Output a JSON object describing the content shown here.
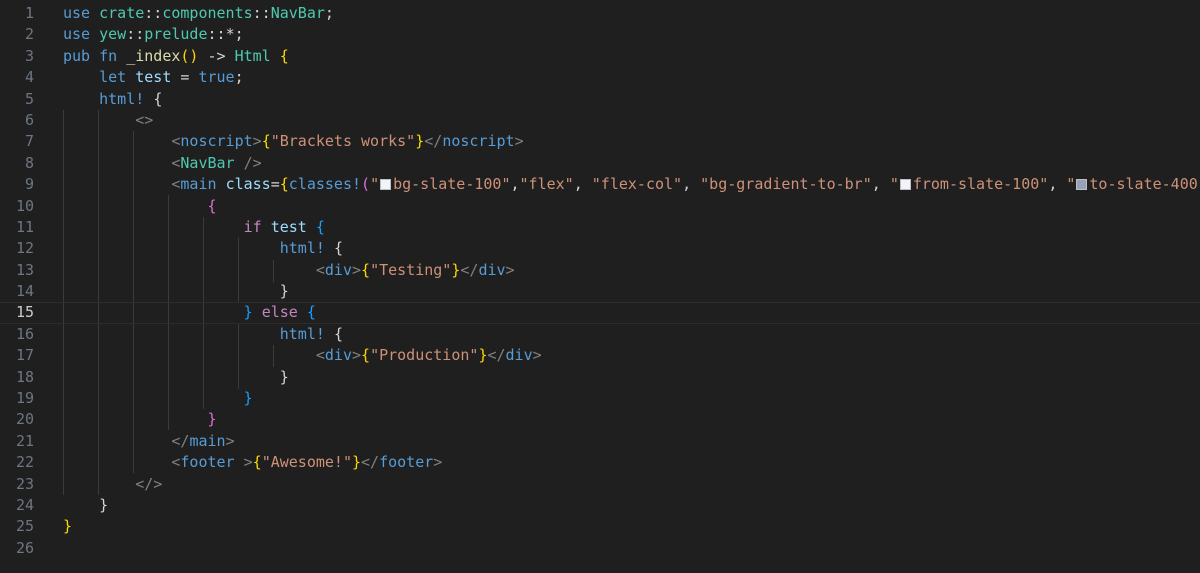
{
  "line_numbers": [
    "1",
    "2",
    "3",
    "4",
    "5",
    "6",
    "7",
    "8",
    "9",
    "10",
    "11",
    "12",
    "13",
    "14",
    "15",
    "16",
    "17",
    "18",
    "19",
    "20",
    "21",
    "22",
    "23",
    "24",
    "25",
    "26"
  ],
  "active_line": "15",
  "colors": {
    "background": "#1f1f1f",
    "swatch_slate_100": "#f1f5f9",
    "swatch_slate_400": "#94a3b8"
  },
  "code": {
    "l1": {
      "kw": "use",
      "ns1": "crate",
      "sep1": "::",
      "ns2": "components",
      "sep2": "::",
      "ty": "NavBar",
      "end": ";"
    },
    "l2": {
      "kw": "use",
      "ns1": "yew",
      "sep1": "::",
      "ns2": "prelude",
      "sep2": "::",
      "rest": "*;"
    },
    "l3": {
      "kw1": "pub",
      "kw2": "fn",
      "name": "_index",
      "parens": "()",
      "arrow": "->",
      "ty": "Html",
      "brace": "{"
    },
    "l4": {
      "kw": "let",
      "var": "test",
      "eq": "=",
      "val": "true",
      "end": ";"
    },
    "l5": {
      "mac": "html!",
      "brace": "{"
    },
    "l6": {
      "frag": "<>"
    },
    "l7": {
      "lt": "<",
      "tag": "noscript",
      "gt": ">",
      "ob": "{",
      "str": "\"Brackets works\"",
      "cb": "}",
      "close": "</",
      "ctag": "noscript",
      "cgt": ">"
    },
    "l8": {
      "lt": "<",
      "tag": "NavBar",
      "end": " />"
    },
    "l9": {
      "lt": "<",
      "tag": "main",
      "attr": "class",
      "eq": "=",
      "ob": "{",
      "mac": "classes!",
      "op": "(",
      "q1": "\"",
      "s1": "bg-slate-100\"",
      "c1": ",",
      "s2": "\"flex\"",
      "c2": ", ",
      "s3": "\"flex-col\"",
      "c3": ", ",
      "s4": "\"bg-gradient-to-br\"",
      "c4": ", ",
      "q5": "\"",
      "s5": "from-slate-100\"",
      "c5": ", ",
      "q6": "\"",
      "s6": "to-slate-400\"",
      "cp": ")",
      "cb": "}",
      "gt": ">"
    },
    "l10": {
      "brace": "{"
    },
    "l11": {
      "kw": "if",
      "var": "test",
      "brace": "{"
    },
    "l12": {
      "mac": "html!",
      "brace": "{"
    },
    "l13": {
      "lt": "<",
      "tag": "div",
      "gt": ">",
      "ob": "{",
      "str": "\"Testing\"",
      "cb": "}",
      "close": "</",
      "ctag": "div",
      "cgt": ">"
    },
    "l14": {
      "brace": "}"
    },
    "l15": {
      "cb": "}",
      "kw": "else",
      "ob": "{"
    },
    "l16": {
      "mac": "html!",
      "brace": "{"
    },
    "l17": {
      "lt": "<",
      "tag": "div",
      "gt": ">",
      "ob": "{",
      "str": "\"Production\"",
      "cb": "}",
      "close": "</",
      "ctag": "div",
      "cgt": ">"
    },
    "l18": {
      "brace": "}"
    },
    "l19": {
      "brace": "}"
    },
    "l20": {
      "brace": "}"
    },
    "l21": {
      "close": "</",
      "tag": "main",
      "gt": ">"
    },
    "l22": {
      "lt": "<",
      "tag": "footer",
      "gt": " >",
      "ob": "{",
      "str": "\"Awesome!\"",
      "cb": "}",
      "close": "</",
      "ctag": "footer",
      "cgt": ">"
    },
    "l23": {
      "frag": "</>"
    },
    "l24": {
      "brace": "}"
    },
    "l25": {
      "brace": "}"
    }
  }
}
